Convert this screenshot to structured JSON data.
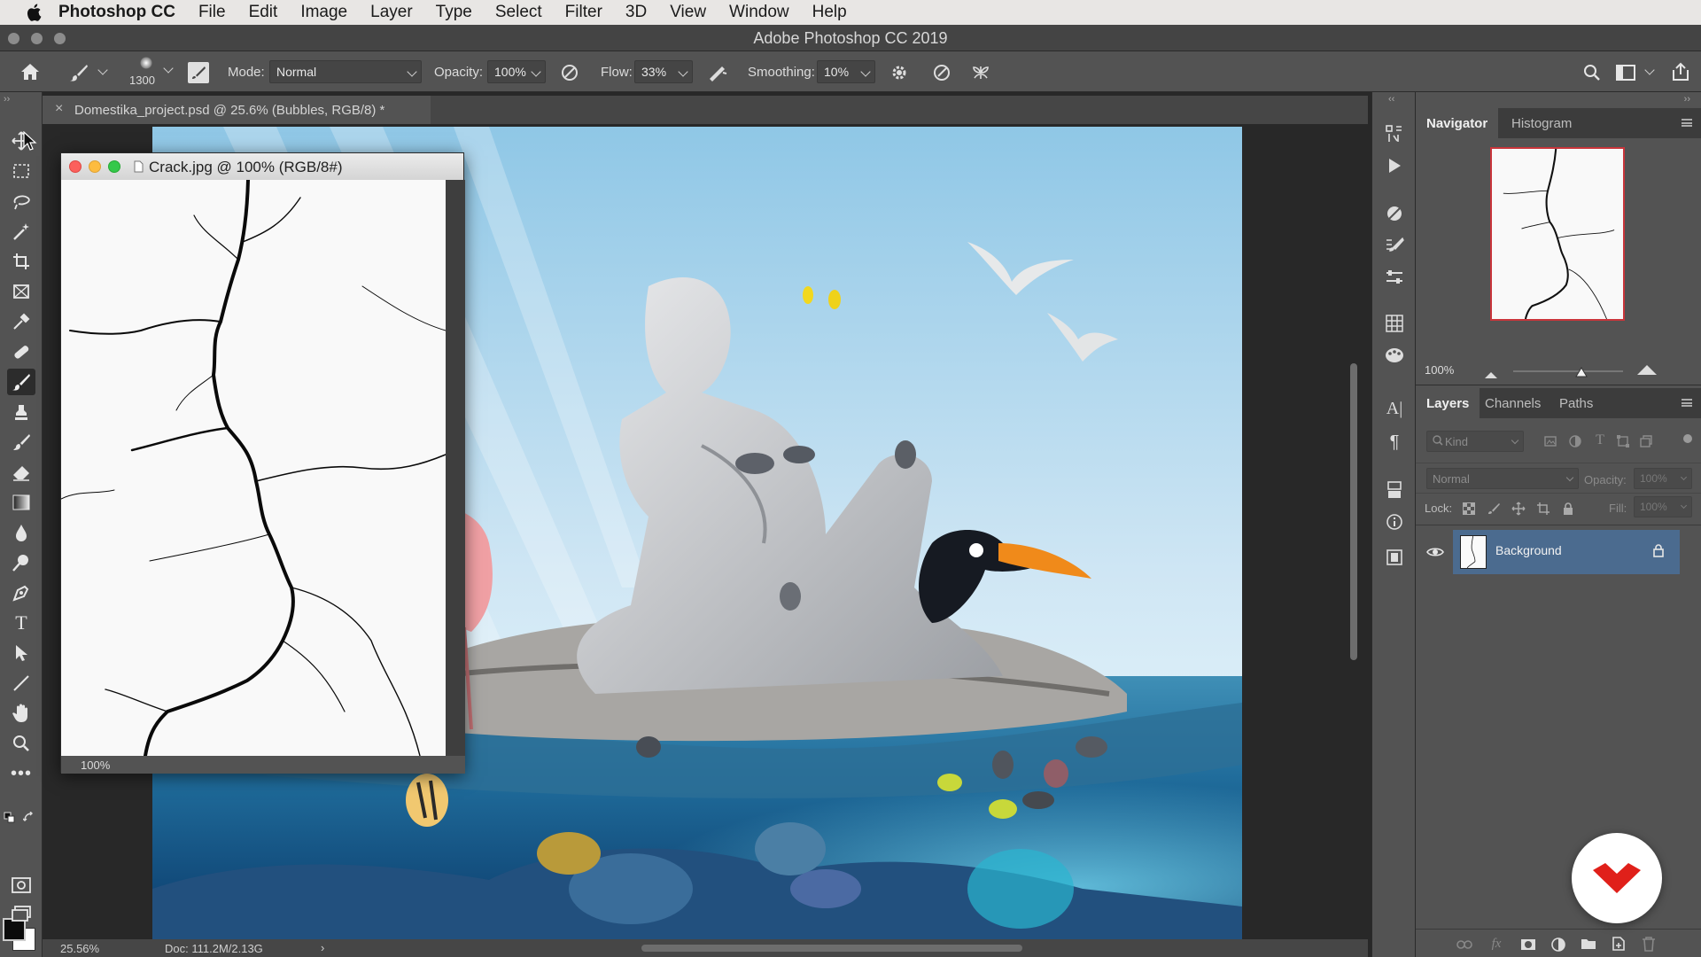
{
  "menubar": {
    "app_name": "Photoshop CC",
    "items": [
      "File",
      "Edit",
      "Image",
      "Layer",
      "Type",
      "Select",
      "Filter",
      "3D",
      "View",
      "Window",
      "Help"
    ]
  },
  "window": {
    "title": "Adobe Photoshop CC 2019"
  },
  "options": {
    "brush_size": "1300",
    "mode_label": "Mode:",
    "mode_value": "Normal",
    "opacity_label": "Opacity:",
    "opacity_value": "100%",
    "flow_label": "Flow:",
    "flow_value": "33%",
    "smoothing_label": "Smoothing:",
    "smoothing_value": "10%"
  },
  "document": {
    "tab_title": "Domestika_project.psd @ 25.6% (Bubbles, RGB/8) *",
    "zoom": "25.56%",
    "doc_info": "Doc: 111.2M/2.13G"
  },
  "floating_window": {
    "title": "Crack.jpg @ 100% (RGB/8#)",
    "zoom": "100%"
  },
  "navigator": {
    "tabs": [
      "Navigator",
      "Histogram"
    ],
    "zoom": "100%"
  },
  "layers": {
    "tabs": [
      "Layers",
      "Channels",
      "Paths"
    ],
    "filter_placeholder": "Kind",
    "blend_mode": "Normal",
    "opacity_label": "Opacity:",
    "opacity_value": "100%",
    "lock_label": "Lock:",
    "fill_label": "Fill:",
    "fill_value": "100%",
    "items": [
      {
        "name": "Background",
        "visible": true,
        "locked": true,
        "selected": true
      }
    ]
  },
  "colors": {
    "selected_layer": "#4b6b8f",
    "logo_red": "#e0201a"
  }
}
